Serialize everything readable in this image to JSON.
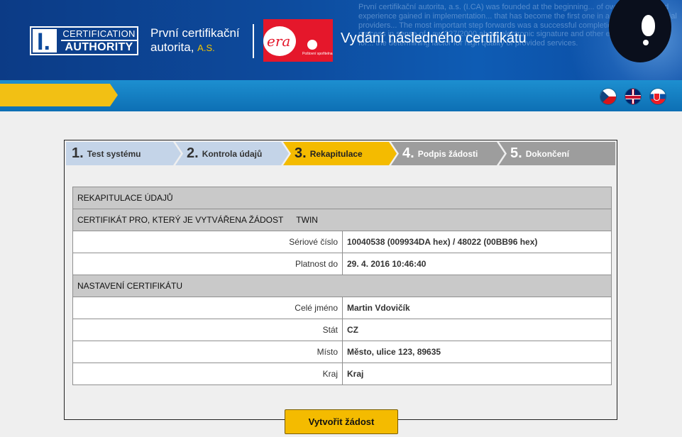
{
  "header": {
    "ca_logo": {
      "line1": "CERTIFICATION",
      "line2": "AUTHORITY",
      "mark": "I."
    },
    "company": {
      "name_line1": "První certifikační",
      "name_line2": "autorita",
      "suffix": "A.S."
    },
    "era_logo": {
      "word": "era",
      "sub": "Poštovní spořitelna"
    },
    "page_heading": "Vydání následného certifikátu",
    "background_text": "První certifikační autorita, a.s. (I.CA) was founded at the beginning... of own expertise and experience gained in implementation... that has become the first one in a field of commercial providers... The most important step forwards was a successful completion of accreditation process in sense of Law 227/2000 about electronic signature and other edicts. The Office for... the determining factor for high quality of provided services."
  },
  "nav": {
    "languages": [
      {
        "code": "cs",
        "icon": "czech-flag-icon"
      },
      {
        "code": "en",
        "icon": "uk-flag-icon"
      },
      {
        "code": "sk",
        "icon": "slovak-flag-icon"
      }
    ]
  },
  "wizard": {
    "steps": [
      {
        "num": "1.",
        "label": "Test systému",
        "state": "done"
      },
      {
        "num": "2.",
        "label": "Kontrola údajů",
        "state": "done"
      },
      {
        "num": "3.",
        "label": "Rekapitulace",
        "state": "active"
      },
      {
        "num": "4.",
        "label": "Podpis žádosti",
        "state": "todo"
      },
      {
        "num": "5.",
        "label": "Dokončení",
        "state": "todo"
      }
    ],
    "recap": {
      "title": "REKAPITULACE ÚDAJŮ",
      "cert_section": "CERTIFIKÁT PRO, KTERÝ JE VYTVÁŘENA ŽÁDOST",
      "cert_type": "TWIN",
      "serial_label": "Sériové číslo",
      "serial_value": "10040538 (009934DA hex) / 48022 (00BB96 hex)",
      "validity_label": "Platnost do",
      "validity_value": "29. 4. 2016 10:46:40",
      "settings_section": "NASTAVENÍ CERTIFIKÁTU",
      "fields": [
        {
          "label": "Celé jméno",
          "value": "Martin Vdovičík"
        },
        {
          "label": "Stát",
          "value": "CZ"
        },
        {
          "label": "Místo",
          "value": "Město, ulice 123, 89635"
        },
        {
          "label": "Kraj",
          "value": "Kraj"
        }
      ]
    },
    "submit_label": "Vytvořit žádost"
  },
  "colors": {
    "header_blue": "#0d4a9c",
    "accent_yellow": "#f4bb00",
    "step_done": "#c4d4e8",
    "step_todo": "#9d9d9d",
    "section_gray": "#c9c9c9"
  }
}
